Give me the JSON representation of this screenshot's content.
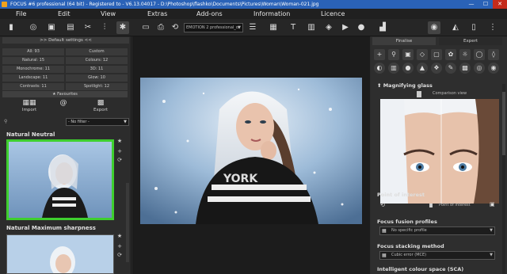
{
  "titlebar": {
    "text": "FOCUS #6 professional (64 bit) - Registered to - V6.13.04017 - D:\\Photoshop\\flashko\\Documents\\Pictures\\Woman\\Woman-021.jpg",
    "min": "—",
    "max": "☐",
    "close": "✕"
  },
  "menu": [
    "File",
    "Edit",
    "View",
    "Extras",
    "Add-ons",
    "Information",
    "Licence"
  ],
  "toolbar": {
    "preset_select": "EMOTION 2 professional_or"
  },
  "left": {
    "default_settings": ">> Default settings <<",
    "categories": [
      {
        "label": "All: 93"
      },
      {
        "label": "Custom"
      },
      {
        "label": "Natural: 15"
      },
      {
        "label": "Colours: 12"
      },
      {
        "label": "Monochrome: 11"
      },
      {
        "label": "3D: 11"
      },
      {
        "label": "Landscape: 11"
      },
      {
        "label": "Glow: 10"
      },
      {
        "label": "Contrasts: 11"
      },
      {
        "label": "Spotlight: 12"
      }
    ],
    "favourites": "Favourites",
    "import": "Import",
    "export": "Export",
    "filter": "- No filter -",
    "presets": [
      "Natural Neutral",
      "Natural Maximum sharpness"
    ]
  },
  "right": {
    "tabs": [
      "Finalise",
      "Expert"
    ],
    "magnifying_glass": "Magnifying glass",
    "comparison_view": "Comparison view",
    "point_of_interest": "Point of interest",
    "point_of_interest_label": "Point of interest",
    "focus_fusion_profiles": "Focus fusion profiles",
    "focus_fusion_value": "No specific profile",
    "focus_stacking_method": "Focus stacking method",
    "focus_stacking_value": "Cubic error (MCE)",
    "intelligent_colour": "Intelligent colour space (SCA)"
  },
  "colors": {
    "titlebar": "#2a62b7",
    "selection": "#3fcf2f",
    "background": "#2b2b2b"
  }
}
